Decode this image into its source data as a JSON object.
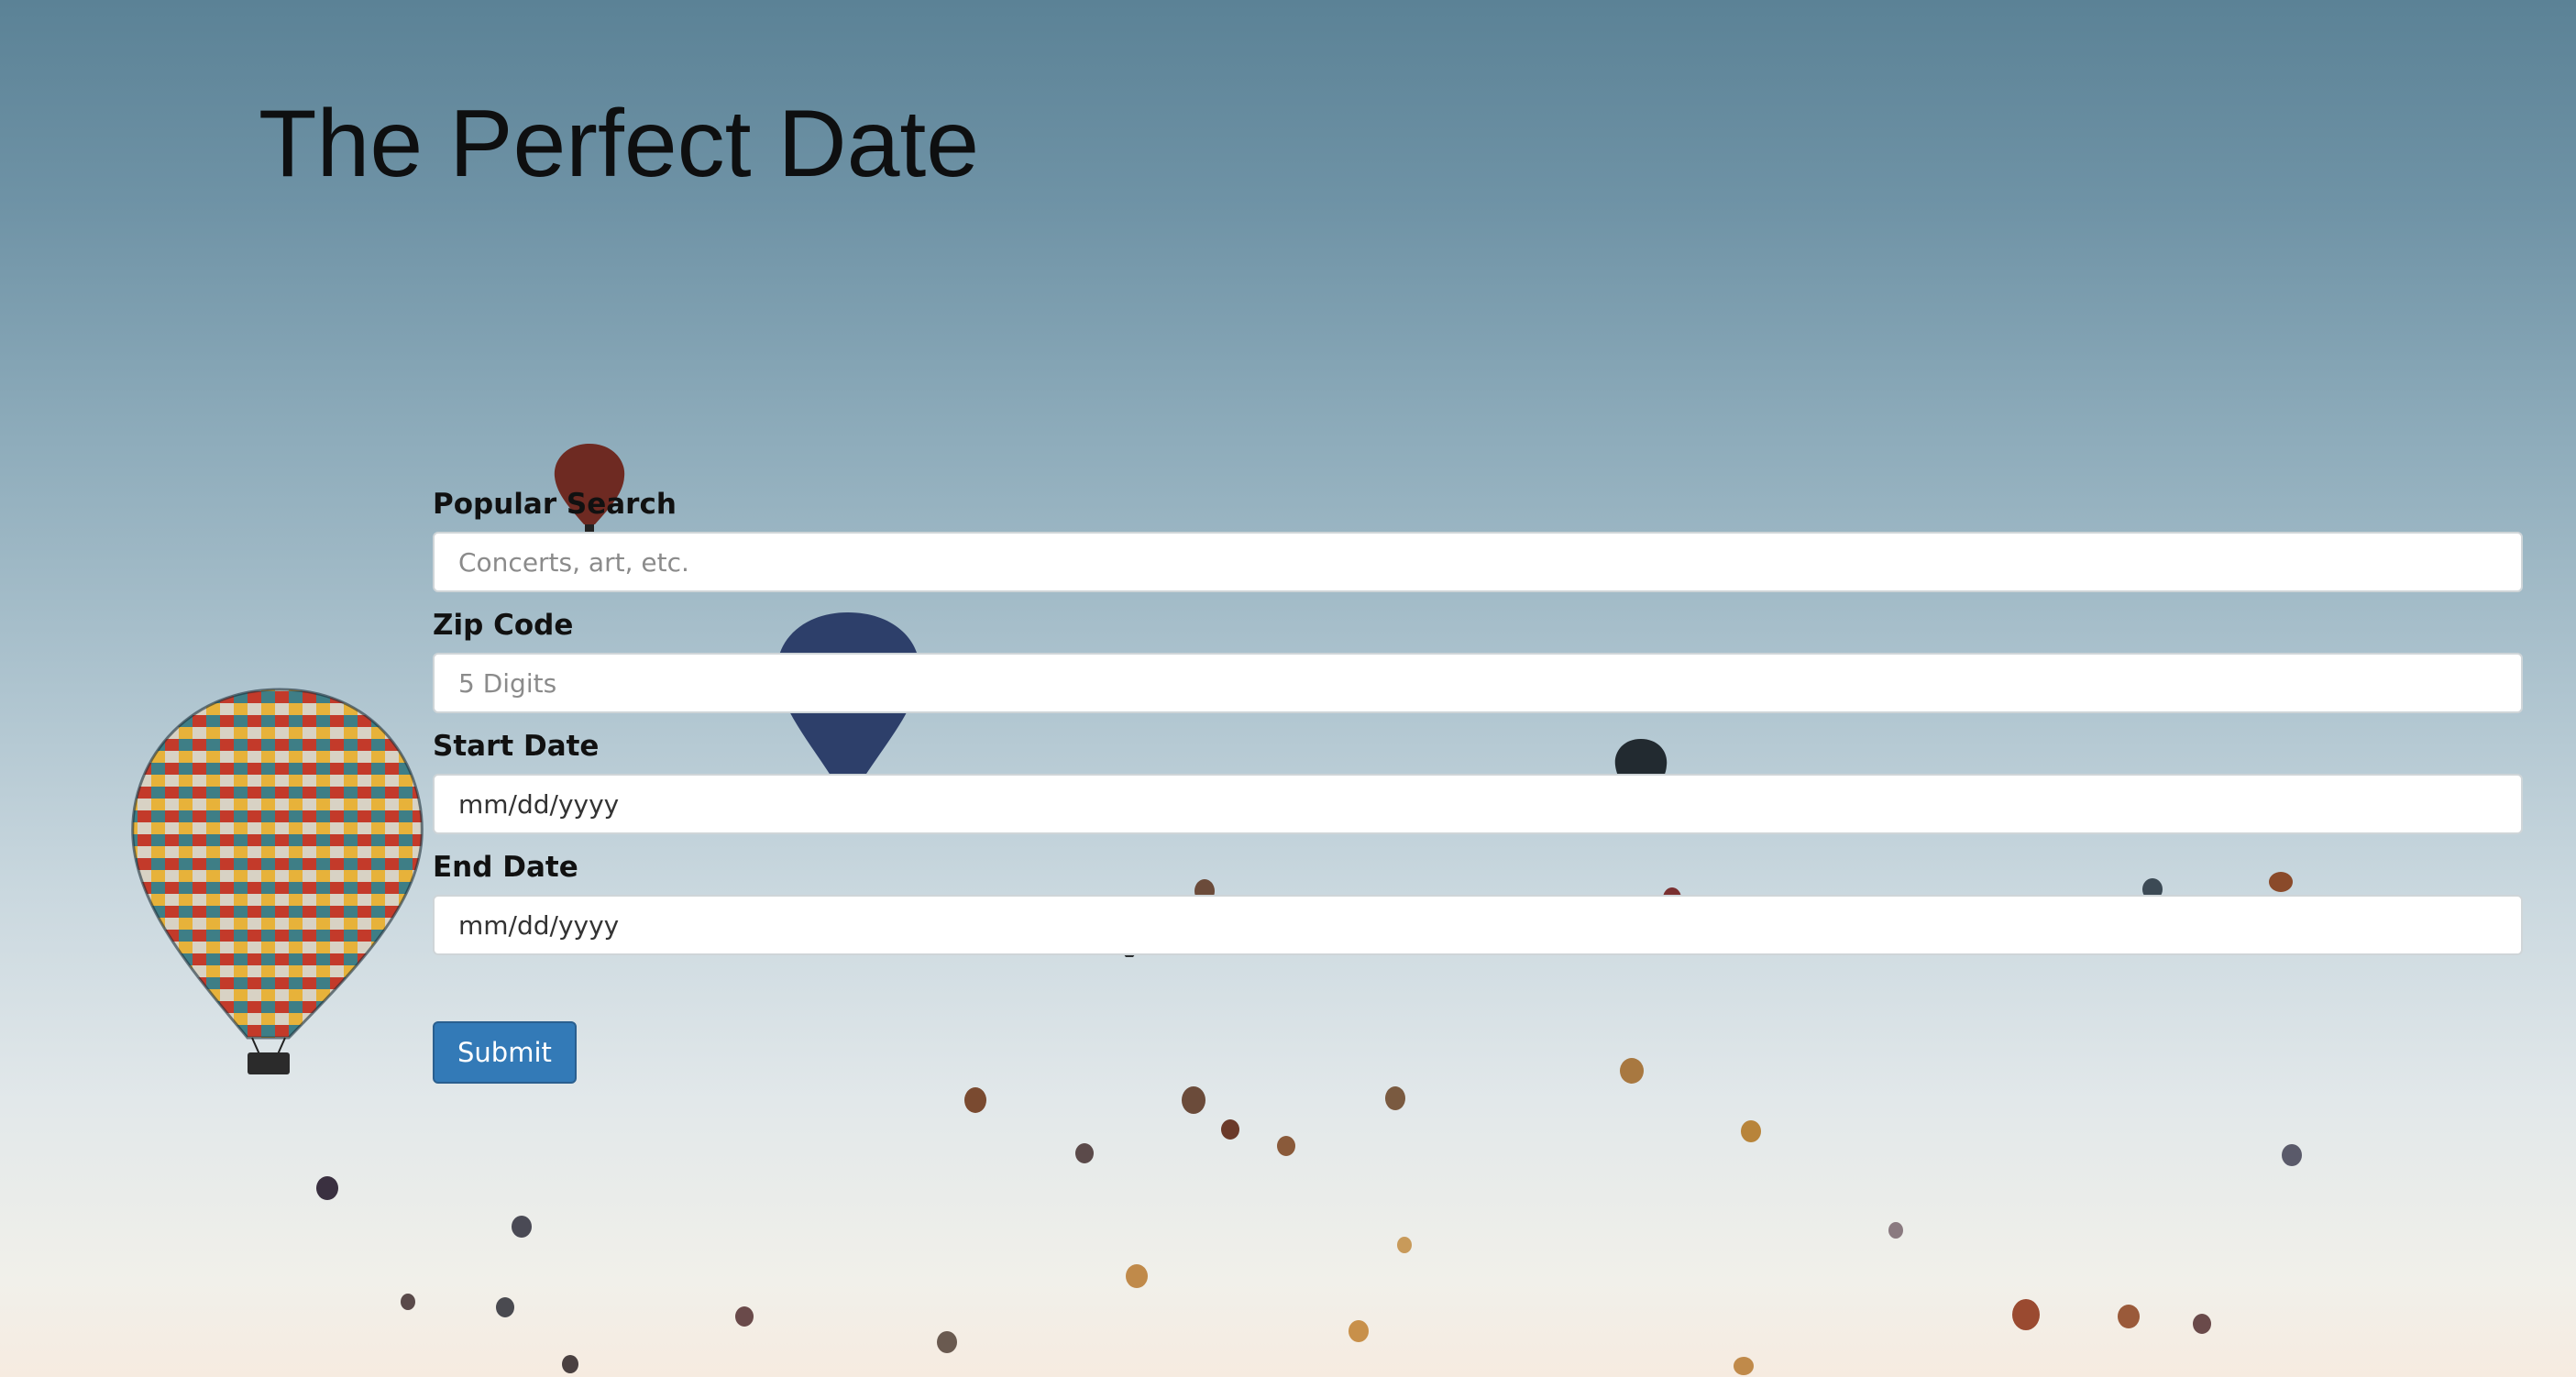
{
  "page": {
    "title": "The Perfect Date"
  },
  "form": {
    "popular_search": {
      "label": "Popular Search",
      "placeholder": "Concerts, art, etc.",
      "value": ""
    },
    "zip_code": {
      "label": "Zip Code",
      "placeholder": "5 Digits",
      "value": ""
    },
    "start_date": {
      "label": "Start Date",
      "display": "mm/dd/yyyy"
    },
    "end_date": {
      "label": "End Date",
      "display": "mm/dd/yyyy"
    },
    "submit_label": "Submit"
  },
  "theme": {
    "button_color": "#337ab7",
    "background_subject": "hot-air-balloons-at-dawn"
  }
}
